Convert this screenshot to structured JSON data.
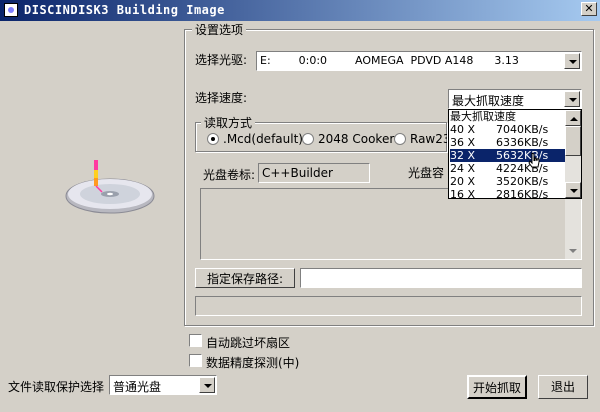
{
  "window": {
    "title": "DISCINDISK3 Building Image",
    "close_glyph": "✕"
  },
  "settings": {
    "group_label": "设置选项",
    "drive_label": "选择光驱:",
    "drive_value": "E:        0:0:0        AOMEGA  PDVD A148      3.13",
    "speed_label": "选择速度:",
    "speed_value": "最大抓取速度"
  },
  "speed_dropdown": {
    "options": [
      "最大抓取速度",
      "40 X      7040KB/s",
      "36 X      6336KB/s",
      "32 X      5632KB/s",
      "24 X      4224KB/s",
      "20 X      3520KB/s",
      "16 X      2816KB/s"
    ],
    "selected_index": 3
  },
  "read_mode": {
    "group_label": "读取方式",
    "options": [
      ".Mcd(default)",
      "2048 Cooker",
      "Raw235"
    ],
    "selected_index": 0
  },
  "volume": {
    "label": "光盘卷标:",
    "value": "C++Builder",
    "capacity_label": "光盘容"
  },
  "save_path": {
    "button_label": "指定保存路径:",
    "value": ""
  },
  "options": {
    "skip_bad_sectors": "自动跳过坏扇区",
    "precision_detect": "数据精度探测(中)"
  },
  "protection": {
    "label": "文件读取保护选择",
    "value": "普通光盘"
  },
  "actions": {
    "start": "开始抓取",
    "exit": "退出"
  },
  "colors": {
    "title_start": "#0a246a",
    "title_end": "#a6caf0",
    "face": "#d4d0c8",
    "selection": "#0a246a"
  }
}
